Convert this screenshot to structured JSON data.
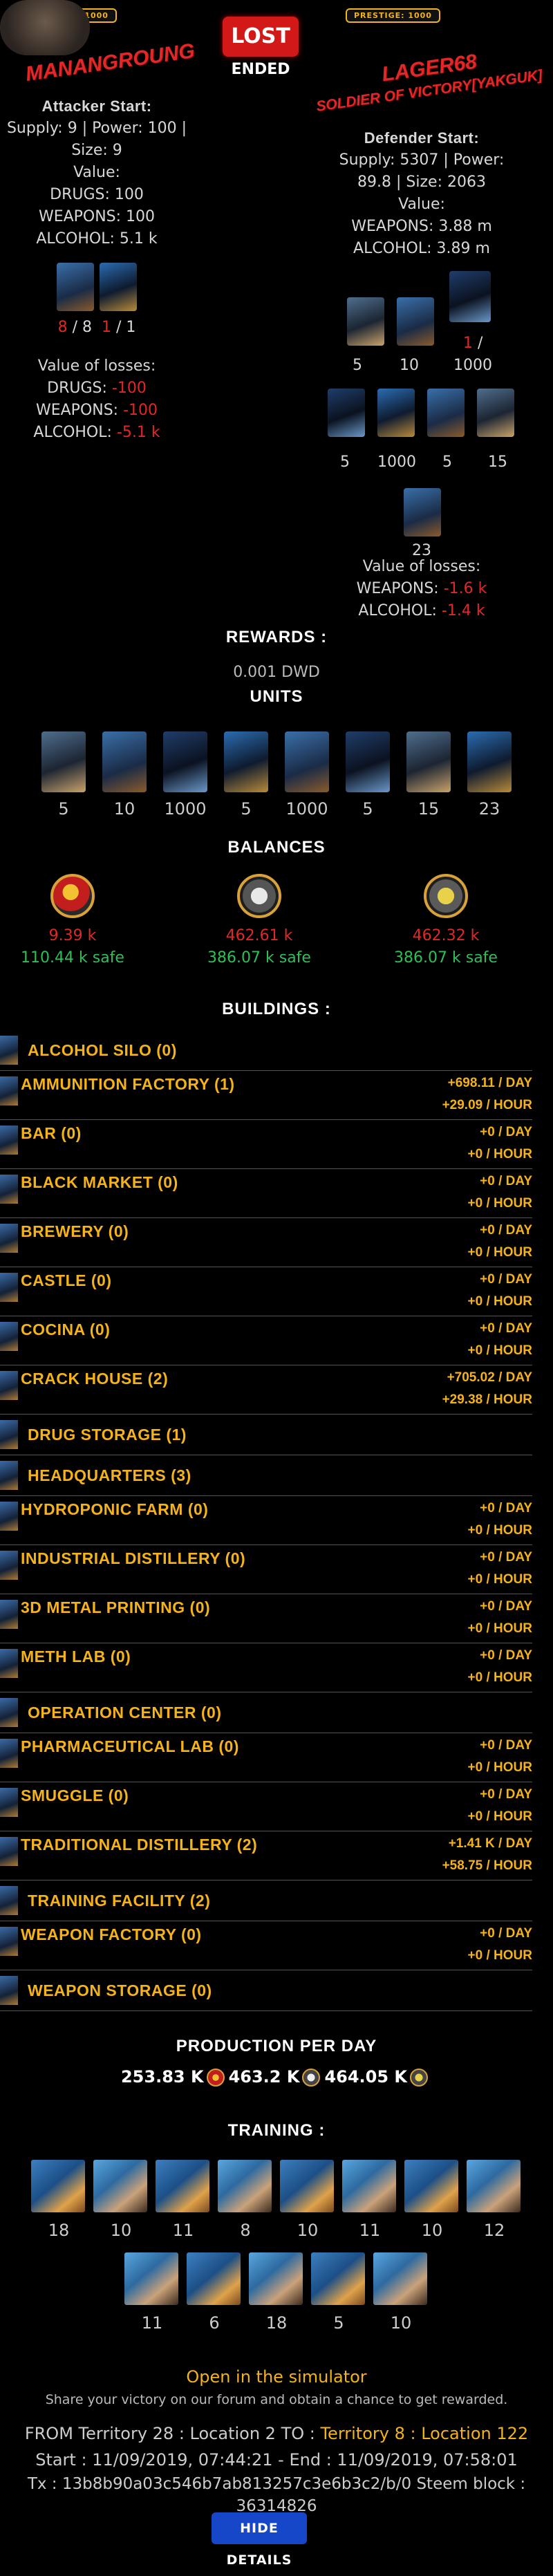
{
  "attacker": {
    "prestige": "PRESTIGE: 1000",
    "name": "MANANGROUNG",
    "start_title": "Attacker Start:",
    "start_line1": "Supply: 9 | Power: 100 |",
    "start_line2": "Size: 9",
    "value_label": "Value:",
    "drugs": "DRUGS: 100",
    "weapons": "WEAPONS: 100",
    "alcohol": "ALCOHOL: 5.1 k",
    "units_lost": "8",
    "units_total": "8",
    "units2_lost": "1",
    "units2_total": "1",
    "losses_title": "Value of losses:",
    "loss_drugs_label": "DRUGS:",
    "loss_drugs": "-100",
    "loss_weapons_label": "WEAPONS:",
    "loss_weapons": "-100",
    "loss_alcohol_label": "ALCOHOL:",
    "loss_alcohol": "-5.1 k"
  },
  "result": {
    "status": "LOST",
    "state": "ENDED"
  },
  "defender": {
    "prestige": "PRESTIGE: 1000",
    "name": "LAGER68",
    "subtitle": "SOLDIER OF VICTORY[YAKGUK]",
    "start_title": "Defender Start:",
    "start_line1": "Supply: 5307 | Power:",
    "start_line2": "89.8 | Size: 2063",
    "value_label": "Value:",
    "weapons": "WEAPONS: 3.88 m",
    "alcohol": "ALCOHOL: 3.89 m",
    "row1_counts": [
      "5",
      "10"
    ],
    "row1_lost": "1",
    "row1_sep": "/",
    "row1_total": "1000",
    "row2_counts": [
      "5",
      "1000",
      "5",
      "15"
    ],
    "row3_count": "23",
    "losses_title": "Value of losses:",
    "loss_weapons_label": "WEAPONS:",
    "loss_weapons": "-1.6 k",
    "loss_alcohol_label": "ALCOHOL:",
    "loss_alcohol": "-1.4 k"
  },
  "rewards": {
    "title": "REWARDS :",
    "dwd": "0.001 DWD",
    "units_title": "UNITS",
    "units": [
      "5",
      "10",
      "1000",
      "5",
      "1000",
      "5",
      "15",
      "23"
    ]
  },
  "balances": {
    "title": "BALANCES",
    "items": [
      {
        "icon": "drugs-coin-icon",
        "value": "9.39 k",
        "safe": "110.44 k safe"
      },
      {
        "icon": "weapons-coin-icon",
        "value": "462.61 k",
        "safe": "386.07 k safe"
      },
      {
        "icon": "alcohol-coin-icon",
        "value": "462.32 k",
        "safe": "386.07 k safe"
      }
    ]
  },
  "buildings": {
    "title": "BUILDINGS :",
    "items": [
      {
        "name": "ALCOHOL SILO (0)",
        "day": "",
        "hour": ""
      },
      {
        "name": "AMMUNITION FACTORY (1)",
        "day": "+698.11 / DAY",
        "hour": "+29.09 / HOUR"
      },
      {
        "name": "BAR (0)",
        "day": "+0 / DAY",
        "hour": "+0 / HOUR"
      },
      {
        "name": "BLACK MARKET (0)",
        "day": "+0 / DAY",
        "hour": "+0 / HOUR"
      },
      {
        "name": "BREWERY (0)",
        "day": "+0 / DAY",
        "hour": "+0 / HOUR"
      },
      {
        "name": "CASTLE (0)",
        "day": "+0 / DAY",
        "hour": "+0 / HOUR"
      },
      {
        "name": "COCINA (0)",
        "day": "+0 / DAY",
        "hour": "+0 / HOUR"
      },
      {
        "name": "CRACK HOUSE (2)",
        "day": "+705.02 / DAY",
        "hour": "+29.38 / HOUR"
      },
      {
        "name": "DRUG STORAGE (1)",
        "day": "",
        "hour": ""
      },
      {
        "name": "HEADQUARTERS (3)",
        "day": "",
        "hour": ""
      },
      {
        "name": "HYDROPONIC FARM (0)",
        "day": "+0 / DAY",
        "hour": "+0 / HOUR"
      },
      {
        "name": "INDUSTRIAL DISTILLERY (0)",
        "day": "+0 / DAY",
        "hour": "+0 / HOUR"
      },
      {
        "name": "3D METAL PRINTING (0)",
        "day": "+0 / DAY",
        "hour": "+0 / HOUR"
      },
      {
        "name": "METH LAB (0)",
        "day": "+0 / DAY",
        "hour": "+0 / HOUR"
      },
      {
        "name": "OPERATION CENTER (0)",
        "day": "",
        "hour": ""
      },
      {
        "name": "PHARMACEUTICAL LAB (0)",
        "day": "+0 / DAY",
        "hour": "+0 / HOUR"
      },
      {
        "name": "SMUGGLE (0)",
        "day": "+0 / DAY",
        "hour": "+0 / HOUR"
      },
      {
        "name": "TRADITIONAL DISTILLERY (2)",
        "day": "+1.41 K / DAY",
        "hour": "+58.75 / HOUR"
      },
      {
        "name": "TRAINING FACILITY (2)",
        "day": "",
        "hour": ""
      },
      {
        "name": "WEAPON FACTORY (0)",
        "day": "+0 / DAY",
        "hour": "+0 / HOUR"
      },
      {
        "name": "WEAPON STORAGE (0)",
        "day": "",
        "hour": ""
      }
    ]
  },
  "production": {
    "title": "PRODUCTION PER DAY",
    "drugs": "253.83 K",
    "weapons": "463.2 K",
    "alcohol": "464.05 K"
  },
  "training": {
    "title": "TRAINING :",
    "row1": [
      "18",
      "10",
      "11",
      "8",
      "10",
      "11",
      "10",
      "12"
    ],
    "row2": [
      "11",
      "6",
      "18",
      "5",
      "10"
    ]
  },
  "footer": {
    "simulator_link": "Open in the simulator",
    "share_text": "Share your victory on our forum and obtain a chance to get rewarded.",
    "from_prefix": "FROM Territory 28 : Location 2 TO : ",
    "to_location": "Territory 8 : Location 122",
    "times": "Start : 11/09/2019, 07:44:21 - End : 11/09/2019, 07:58:01",
    "tx": "Tx : 13b8b90a03c546b7ab813257c3e6b3c2/b/0 Steem block :",
    "block": "36314826",
    "hide_button": "HIDE DETAILS"
  }
}
